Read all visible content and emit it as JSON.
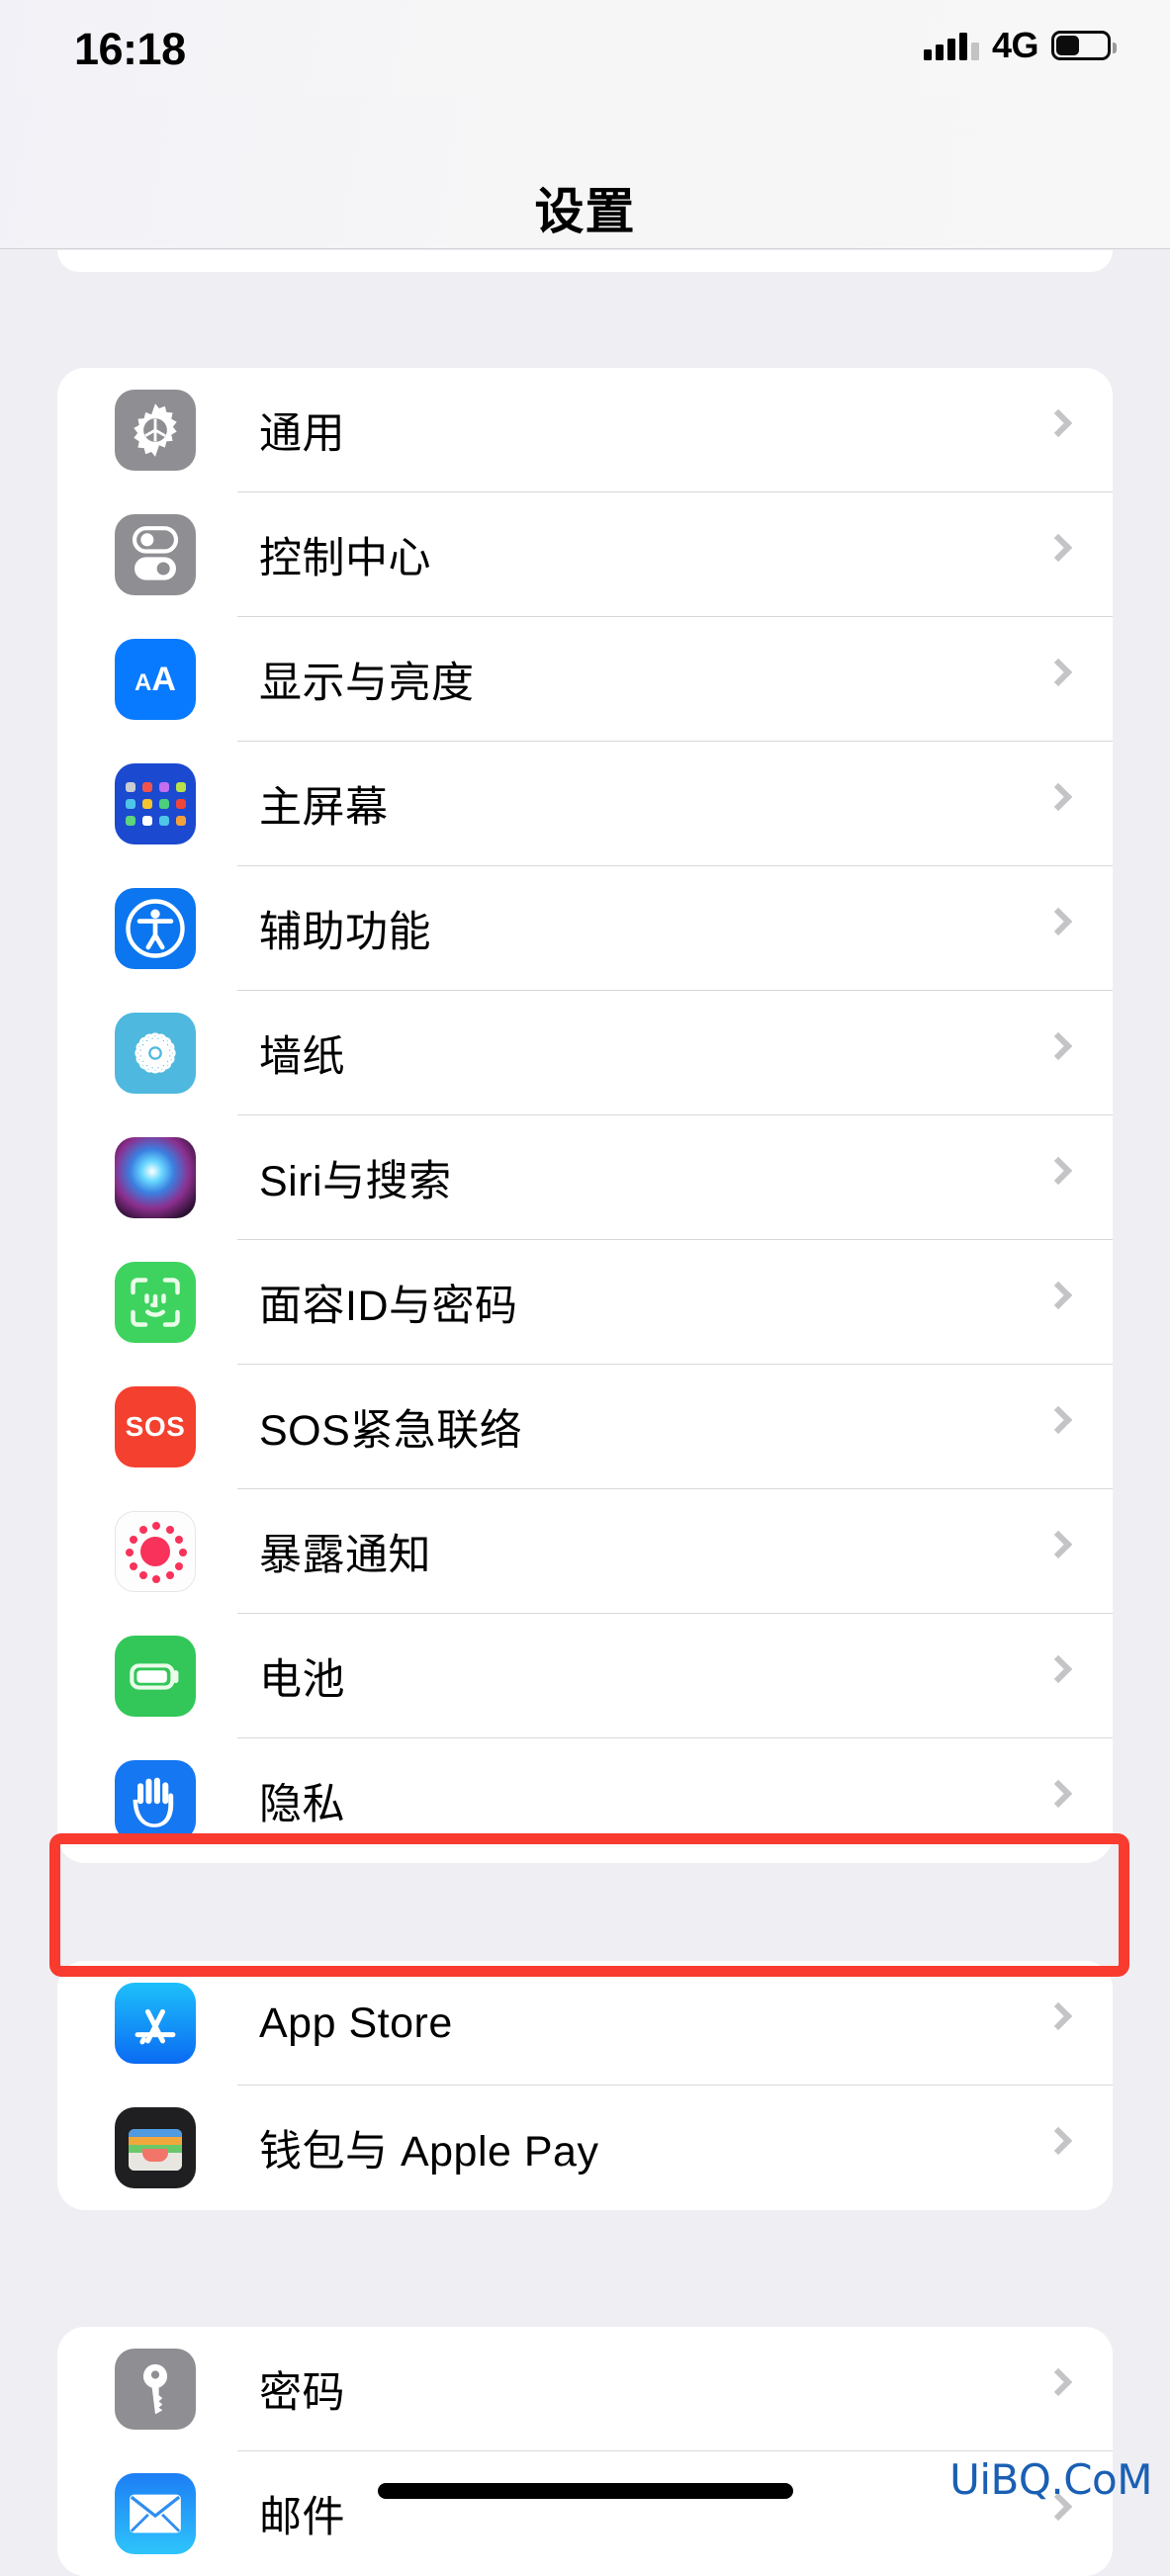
{
  "status_bar": {
    "time": "16:18",
    "network": "4G",
    "signal_icon": "cellular-bars-icon",
    "battery_icon": "battery-icon",
    "battery_level_percent": 42
  },
  "nav": {
    "title": "设置"
  },
  "colors": {
    "page_background": "#efeef3",
    "card_background": "#ffffff",
    "separator": "#d8d8dc",
    "chevron": "#c4c4c7",
    "highlight_box": "#f93a2f",
    "watermark": "#1a5fb4"
  },
  "highlight": {
    "target_row_label": "电池",
    "color": "#f93a2f"
  },
  "groups": [
    {
      "name": "clipped-top-group",
      "clipped": true,
      "rows": []
    },
    {
      "name": "system-settings-group",
      "rows": [
        {
          "label": "通用",
          "icon": "gear-icon",
          "chevron": "chevron-right-icon"
        },
        {
          "label": "控制中心",
          "icon": "control-center-icon",
          "chevron": "chevron-right-icon"
        },
        {
          "label": "显示与亮度",
          "icon": "display-brightness-icon",
          "chevron": "chevron-right-icon"
        },
        {
          "label": "主屏幕",
          "icon": "home-screen-icon",
          "chevron": "chevron-right-icon"
        },
        {
          "label": "辅助功能",
          "icon": "accessibility-icon",
          "chevron": "chevron-right-icon"
        },
        {
          "label": "墙纸",
          "icon": "wallpaper-icon",
          "chevron": "chevron-right-icon"
        },
        {
          "label": "Siri与搜索",
          "icon": "siri-icon",
          "chevron": "chevron-right-icon"
        },
        {
          "label": "面容ID与密码",
          "icon": "face-id-icon",
          "chevron": "chevron-right-icon"
        },
        {
          "label": "SOS紧急联络",
          "icon": "sos-icon",
          "chevron": "chevron-right-icon"
        },
        {
          "label": "暴露通知",
          "icon": "exposure-notifications-icon",
          "chevron": "chevron-right-icon"
        },
        {
          "label": "电池",
          "icon": "battery-settings-icon",
          "chevron": "chevron-right-icon"
        },
        {
          "label": "隐私",
          "icon": "privacy-hand-icon",
          "chevron": "chevron-right-icon"
        }
      ]
    },
    {
      "name": "store-group",
      "rows": [
        {
          "label": "App Store",
          "icon": "app-store-icon",
          "chevron": "chevron-right-icon"
        },
        {
          "label": "钱包与 Apple Pay",
          "icon": "wallet-icon",
          "chevron": "chevron-right-icon"
        }
      ]
    },
    {
      "name": "accounts-group",
      "rows": [
        {
          "label": "密码",
          "icon": "passwords-key-icon",
          "chevron": "chevron-right-icon"
        },
        {
          "label": "邮件",
          "icon": "mail-icon",
          "chevron": "chevron-right-icon"
        }
      ]
    }
  ],
  "watermark": {
    "text": "UiBQ.CoM"
  }
}
